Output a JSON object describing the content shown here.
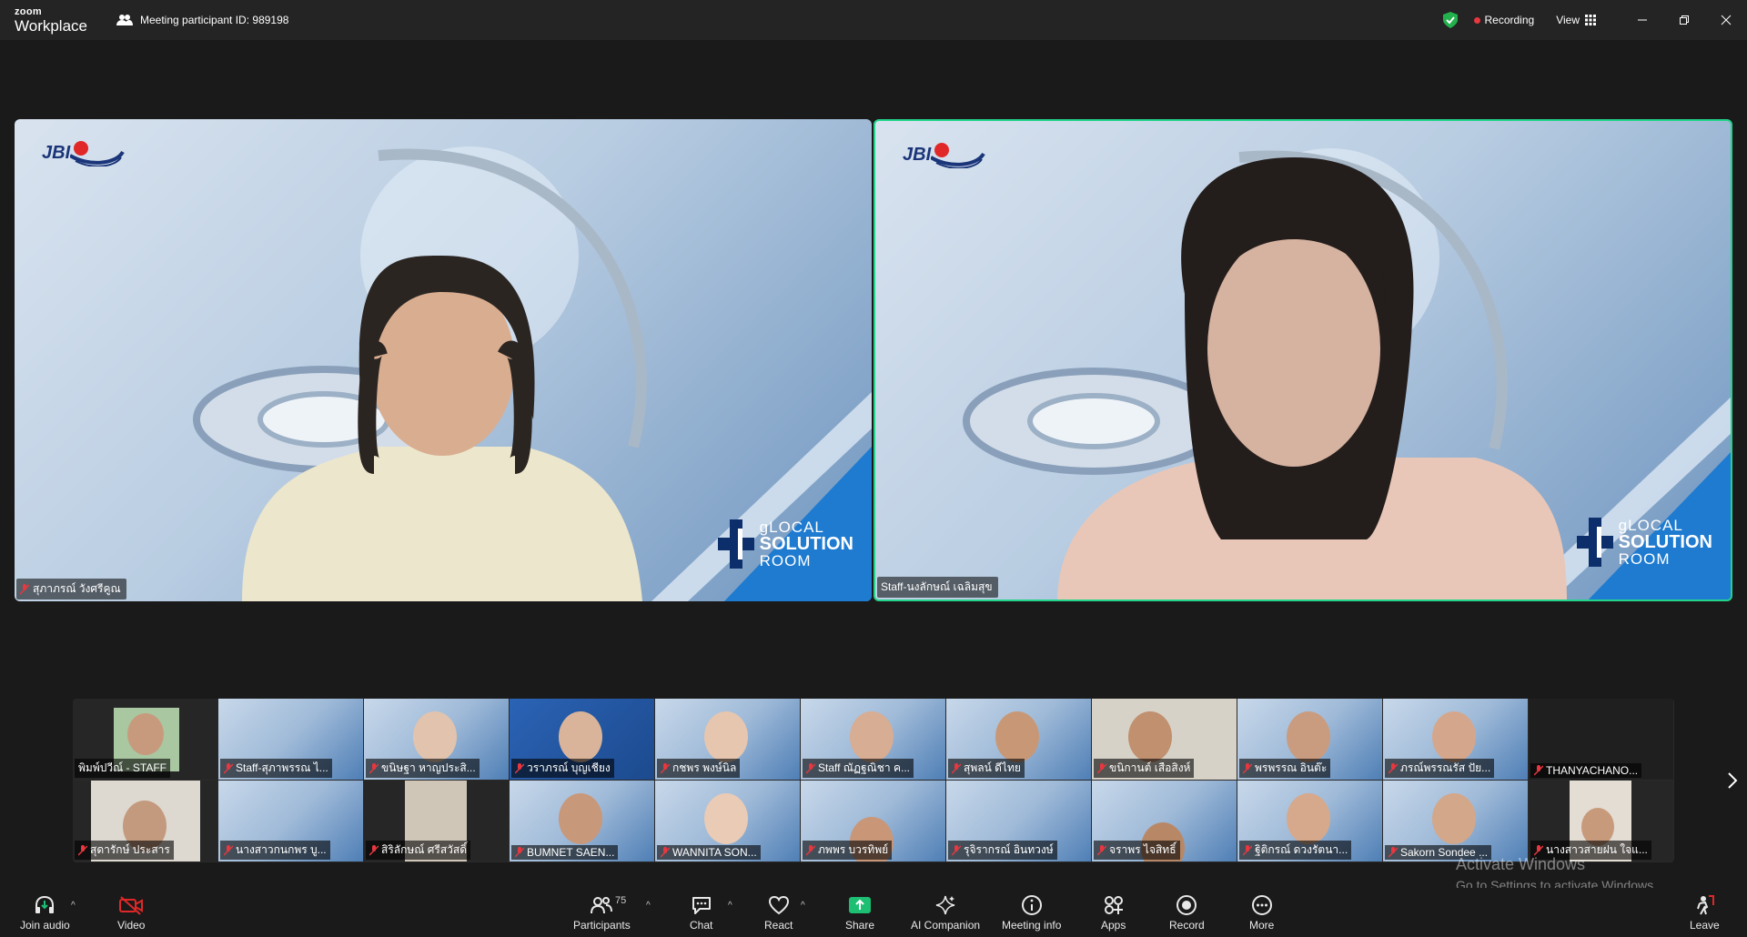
{
  "titlebar": {
    "brand_small": "zoom",
    "brand_main": "Workplace",
    "meeting_id": "Meeting participant ID: 989198",
    "recording": "Recording",
    "view": "View"
  },
  "tiles": {
    "left": {
      "name": "สุภาภรณ์ วังศรีคูณ",
      "logo": "JBI"
    },
    "right": {
      "name": "Staff-นงลักษณ์ เฉลิมสุข",
      "logo": "JBI"
    },
    "room_line1": "gLOCAL",
    "room_line2": "SOLUTION",
    "room_line3": "ROOM"
  },
  "gallery": {
    "row1": [
      "พิมพ์ปวีณ์ - STAFF",
      "Staff-สุภาพรรณ ไ...",
      "ขนิษฐา หาญประสิ...",
      "วราภรณ์ บุญเชียง",
      "กชพร พงษ์นิล",
      "Staff ณัฏฐณิชา ค...",
      "สุพลน์ ดีไทย",
      "ขนิกานต์ เสือสิงห์",
      "พรพรรณ อินต๊ะ",
      "ภรณ์พรรณรัส ปัย...",
      "THANYACHANO..."
    ],
    "row2": [
      "สุดารักษ์ ประสาร",
      "นางสาวกนกพร บู...",
      "สิริลักษณ์ ศรีสวัสดิ์",
      "BUMNET SAEN...",
      "WANNITA SON...",
      "ภพพร บวรทิพย์",
      "รุจิรากรณ์ อินทวงษ์",
      "จราพร ไจสิทธิ์",
      "ฐิติกรณ์ ดวงรัตนา...",
      "Sakorn Sondee ...",
      "นางสาวสายฝน ใจแ..."
    ]
  },
  "watermark": {
    "line1": "Activate Windows",
    "line2": "Go to Settings to activate Windows."
  },
  "toolbar": {
    "join_audio": "Join audio",
    "video": "Video",
    "participants": "Participants",
    "participants_count": "75",
    "chat": "Chat",
    "react": "React",
    "share": "Share",
    "ai_companion": "AI Companion",
    "meeting_info": "Meeting info",
    "apps": "Apps",
    "record": "Record",
    "more": "More",
    "leave": "Leave"
  },
  "colors": {
    "active_speaker_border": "#22d48a",
    "share_green": "#1dbf73",
    "recording_red": "#e8373f",
    "leave_red": "#e02828"
  }
}
